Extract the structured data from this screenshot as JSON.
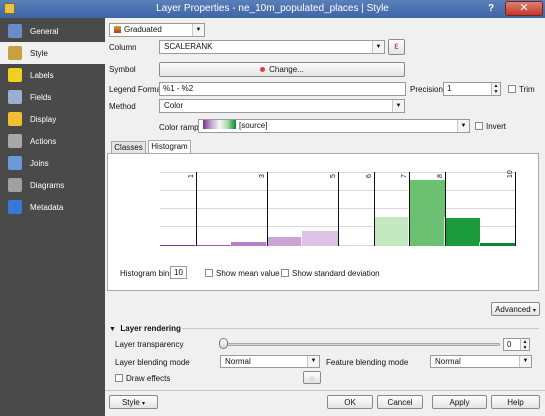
{
  "window": {
    "title": "Layer Properties - ne_10m_populated_places | Style",
    "help": "?",
    "close": "✕"
  },
  "sidebar": {
    "items": [
      {
        "label": "General",
        "icon": "wrench-icon",
        "color": "#6a8cc8"
      },
      {
        "label": "Style",
        "icon": "paintbrush-icon",
        "color": "#c8a040"
      },
      {
        "label": "Labels",
        "icon": "abc-icon",
        "color": "#f0d020"
      },
      {
        "label": "Fields",
        "icon": "table-icon",
        "color": "#9ab0d0"
      },
      {
        "label": "Display",
        "icon": "speech-bubble-icon",
        "color": "#f0c030"
      },
      {
        "label": "Actions",
        "icon": "gear-icon",
        "color": "#a8a8a8"
      },
      {
        "label": "Joins",
        "icon": "join-icon",
        "color": "#6a9ad8"
      },
      {
        "label": "Diagrams",
        "icon": "diagram-icon",
        "color": "#a0a0a0"
      },
      {
        "label": "Metadata",
        "icon": "info-icon",
        "color": "#3a78d8"
      }
    ],
    "active_index": 1
  },
  "renderer": {
    "value": "Graduated"
  },
  "column": {
    "label": "Column",
    "value": "SCALERANK",
    "expr_button": "ε"
  },
  "symbol": {
    "label": "Symbol",
    "button": "Change..."
  },
  "legend_format": {
    "label": "Legend Format",
    "value": "%1 - %2"
  },
  "precision": {
    "label": "Precision",
    "value": "1"
  },
  "trim": {
    "label": "Trim"
  },
  "method": {
    "label": "Method",
    "value": "Color"
  },
  "color_ramp": {
    "label": "Color ramp",
    "value": "[source]"
  },
  "invert": {
    "label": "Invert"
  },
  "tabs": [
    "Classes",
    "Histogram"
  ],
  "histogram": {
    "bars": [
      {
        "from": 0,
        "to": 1,
        "count": 2,
        "color": "#7b3294",
        "lighter": "#7b3294"
      },
      {
        "from": 1,
        "to": 2,
        "count": 2,
        "color": "#9a5ab0",
        "lighter": "#9a5ab0"
      },
      {
        "from": 2,
        "to": 3,
        "count": 5,
        "color": "#b580c4",
        "lighter": "#b580c4"
      },
      {
        "from": 3,
        "to": 4,
        "count": 12,
        "color": "#cba4d6",
        "lighter": "#cba4d6"
      },
      {
        "from": 4,
        "to": 5,
        "count": 20,
        "color": "#dcc4e6",
        "lighter": "#dcc4e6"
      },
      {
        "from": 6,
        "to": 7,
        "count": 40,
        "color": "#c4e8c0",
        "lighter": "#c4e8c0"
      },
      {
        "from": 7,
        "to": 8,
        "count": 90,
        "color": "#6cc072",
        "lighter": "#6cc072"
      },
      {
        "from": 8,
        "to": 9,
        "count": 38,
        "color": "#1a9a3a",
        "lighter": "#1a9a3a"
      },
      {
        "from": 9,
        "to": 10,
        "count": 4,
        "color": "#0a8a2a",
        "lighter": "#0a8a2a"
      }
    ],
    "breaks": [
      "1",
      "3",
      "5",
      "6",
      "7",
      "8",
      "10"
    ],
    "break_values": [
      1,
      3,
      5,
      6,
      7,
      8,
      10
    ],
    "x_range": [
      0,
      10
    ],
    "max_count": 100,
    "bins_label": "Histogram bins",
    "bins_value": "10",
    "show_mean": "Show mean value",
    "show_std": "Show standard deviation"
  },
  "advanced": {
    "label": "Advanced"
  },
  "layer_rendering": {
    "title": "Layer rendering",
    "transparency_label": "Layer transparency",
    "transparency_value": "0",
    "blending_label": "Layer blending mode",
    "blending_value": "Normal",
    "feature_blending_label": "Feature blending mode",
    "feature_blending_value": "Normal",
    "draw_effects_label": "Draw effects"
  },
  "footer": {
    "style": "Style",
    "ok": "OK",
    "cancel": "Cancel",
    "apply": "Apply",
    "help": "Help"
  }
}
